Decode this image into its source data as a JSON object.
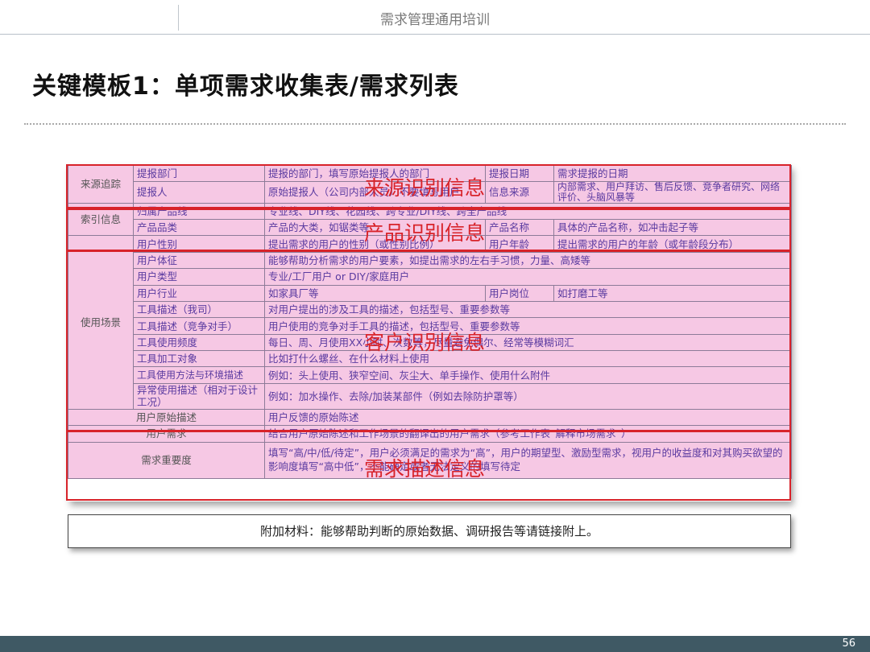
{
  "header": {
    "title": "需求管理通用培训"
  },
  "slide": {
    "title": "关键模板1：单项需求收集表/需求列表"
  },
  "table": {
    "rows": [
      [
        "来源追踪",
        "提报部门",
        "提报的部门，填写原始提报人的部门",
        "提报日期",
        "需求提报的日期"
      ],
      [
        "",
        "提报人",
        "原始提报人（公司内部人员）不要填写用户",
        "信息来源",
        "内部需求、用户拜访、售后反馈、竞争者研究、网络评价、头脑风暴等"
      ],
      [
        "索引信息",
        "归属产品线",
        "专业线、DIY线、花园线、跨专业/DIY线、跨全产品线"
      ],
      [
        "",
        "产品品类",
        "产品的大类，如锯类等",
        "产品名称",
        "具体的产品名称，如冲击起子等"
      ],
      [
        "使用场景",
        "用户性别",
        "提出需求的用户的性别（或性别比例）",
        "用户年龄",
        "提出需求的用户的年龄（或年龄段分布）"
      ],
      [
        "",
        "用户体征",
        "能够帮助分析需求的用户要素，如提出需求的左右手习惯，力量、高矮等"
      ],
      [
        "",
        "用户类型",
        "专业/工厂用户 or DIY/家庭用户"
      ],
      [
        "",
        "用户行业",
        "如家具厂等",
        "用户岗位",
        "如打磨工等"
      ],
      [
        "",
        "工具描述（我司）",
        "对用户提出的涉及工具的描述，包括型号、重要参数等"
      ],
      [
        "",
        "工具描述（竞争对手）",
        "用户使用的竞争对手工具的描述，包括型号、重要参数等"
      ],
      [
        "",
        "工具使用频度",
        "每日、周、月使用XX小时、次数等，尽量避免偶尔、经常等模糊词汇"
      ],
      [
        "",
        "工具加工对象",
        "比如打什么螺丝、在什么材料上使用"
      ],
      [
        "",
        "工具使用方法与环境描述",
        "例如：头上使用、狭窄空间、灰尘大、单手操作、使用什么附件"
      ],
      [
        "",
        "异常使用描述（相对于设计工况）",
        "例如：加水操作、去除/加装某部件（例如去除防护罩等）"
      ],
      [
        "用户原始描述",
        "用户反馈的原始陈述"
      ],
      [
        "用户需求",
        "结合用户原始陈述和工作场景的翻译出的用户需求（参考工作表“解释市场需求”）"
      ],
      [
        "需求重要度",
        "填写“高/中/低/待定”，用户必须满足的需求为“高”，用户的期望型、激励型需求，视用户的收益度和对其购买欲望的影响度填写“高中低”，不能确定或者无法定义的填写待定"
      ]
    ]
  },
  "overlays": {
    "source": "来源识别信息",
    "product": "产品识别信息",
    "customer": "客户识别信息",
    "demand": "需求描述信息"
  },
  "attachment": "附加材料：能够帮助判断的原始数据、调研报告等请链接附上。",
  "footer": {
    "page": "56"
  },
  "colors": {
    "cell_bg": "#f6c8e4",
    "cell_text": "#5a3aa0",
    "highlight": "#d8232a",
    "footer_bar": "#3f5964"
  }
}
